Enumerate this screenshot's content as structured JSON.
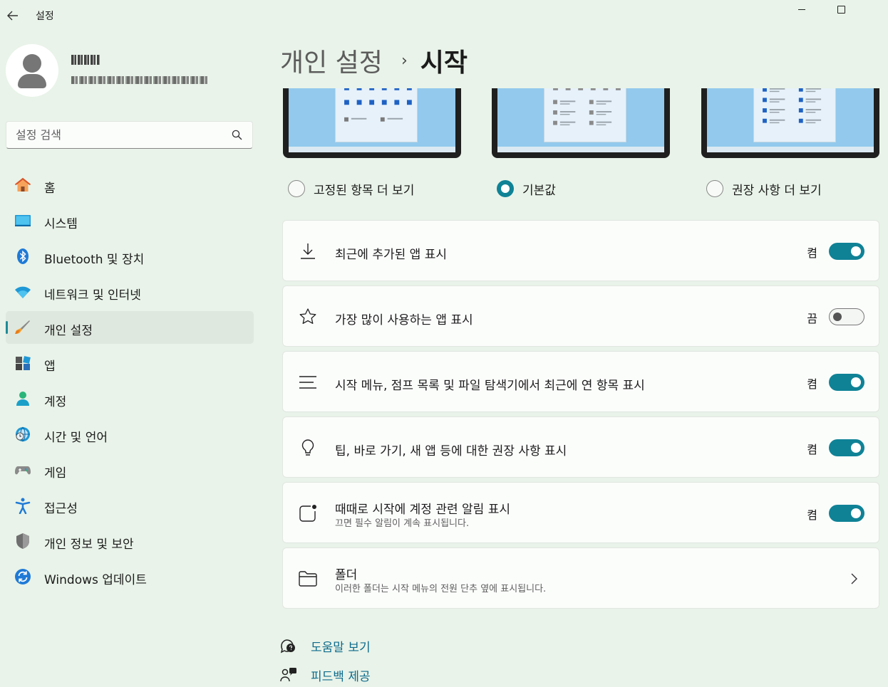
{
  "window": {
    "title": "설정",
    "accent": "#0f8296"
  },
  "search": {
    "placeholder": "설정 검색"
  },
  "nav": {
    "items": [
      {
        "label": "홈",
        "icon": "home-icon"
      },
      {
        "label": "시스템",
        "icon": "system-icon"
      },
      {
        "label": "Bluetooth 및 장치",
        "icon": "bluetooth-icon"
      },
      {
        "label": "네트워크 및 인터넷",
        "icon": "wifi-icon"
      },
      {
        "label": "개인 설정",
        "icon": "personalization-brush-icon",
        "active": true
      },
      {
        "label": "앱",
        "icon": "apps-icon"
      },
      {
        "label": "계정",
        "icon": "account-icon"
      },
      {
        "label": "시간 및 언어",
        "icon": "time-language-icon"
      },
      {
        "label": "게임",
        "icon": "gaming-icon"
      },
      {
        "label": "접근성",
        "icon": "accessibility-icon"
      },
      {
        "label": "개인 정보 및 보안",
        "icon": "privacy-shield-icon"
      },
      {
        "label": "Windows 업데이트",
        "icon": "windows-update-icon"
      }
    ]
  },
  "breadcrumb": {
    "parent": "개인 설정",
    "separator": "›",
    "current": "시작"
  },
  "layout": {
    "options": [
      {
        "label": "고정된 항목 더 보기",
        "selected": false
      },
      {
        "label": "기본값",
        "selected": true
      },
      {
        "label": "권장 사항 더 보기",
        "selected": false
      }
    ]
  },
  "settings": [
    {
      "title": "최근에 추가된 앱 표시",
      "state": "켬",
      "on": true,
      "icon": "download-icon"
    },
    {
      "title": "가장 많이 사용하는 앱 표시",
      "state": "끔",
      "on": false,
      "icon": "star-icon"
    },
    {
      "title": "시작 메뉴, 점프 목록 및 파일 탐색기에서 최근에 연 항목 표시",
      "state": "켬",
      "on": true,
      "icon": "list-icon"
    },
    {
      "title": "팁, 바로 가기, 새 앱 등에 대한 권장 사항 표시",
      "state": "켬",
      "on": true,
      "icon": "lightbulb-icon"
    },
    {
      "title": "때때로 시작에 계정 관련 알림 표시",
      "subtitle": "끄면 필수 알림이 계속 표시됩니다.",
      "state": "켬",
      "on": true,
      "icon": "notification-icon"
    },
    {
      "title": "폴더",
      "subtitle": "이러한 폴더는 시작 메뉴의 전원 단추 옆에 표시됩니다.",
      "icon": "folder-icon"
    }
  ],
  "help": {
    "get_help": "도움말 보기",
    "feedback": "피드백 제공"
  }
}
